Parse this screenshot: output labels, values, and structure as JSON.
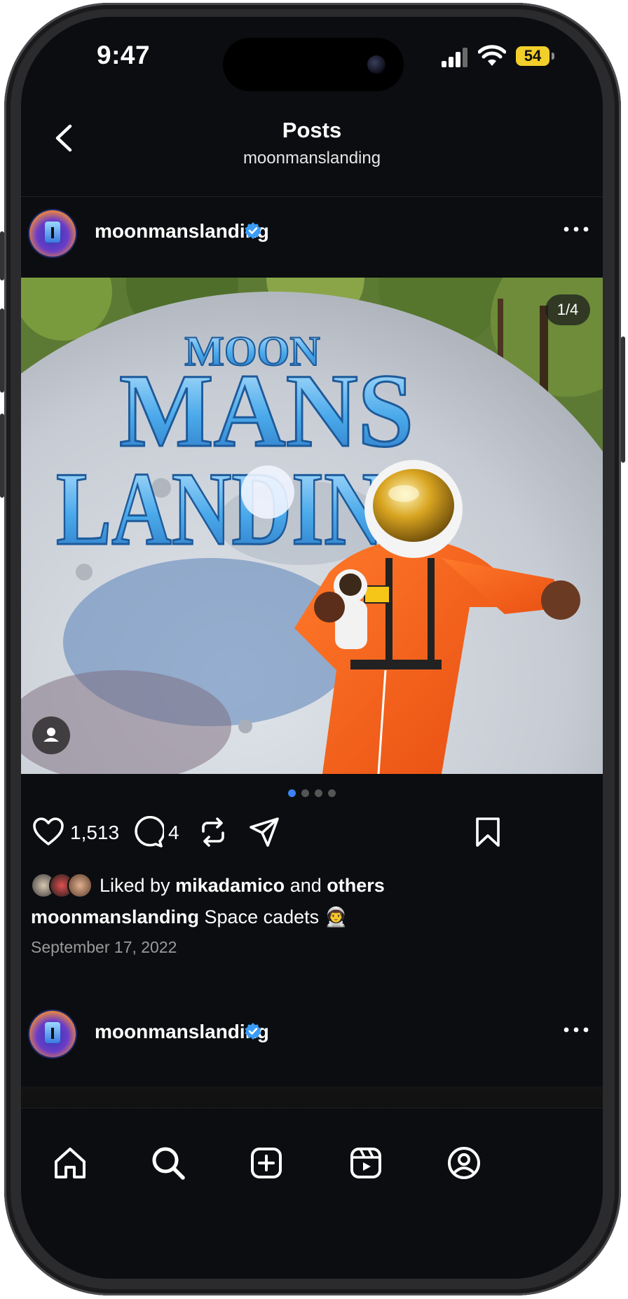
{
  "status_bar": {
    "time": "9:47",
    "battery": "54",
    "battery_color": "#f2cf2a"
  },
  "header": {
    "title": "Posts",
    "subtitle": "moonmanslanding"
  },
  "post": {
    "username": "moonmanslanding",
    "image_counter": "1/4",
    "image_alt": "MOON MANS LANDING",
    "carousel": {
      "total": 4,
      "active": 1
    },
    "actions": {
      "like_count": "1,513",
      "comment_count": "4"
    },
    "liked_by": {
      "prefix": "Liked by",
      "user": "mikadamico",
      "conj": "and",
      "others": "others"
    },
    "caption": {
      "username": "moonmanslanding",
      "text": "Space cadets 👨‍🚀"
    },
    "date": "September 17, 2022"
  },
  "post2": {
    "username": "moonmanslanding"
  },
  "icons": {
    "back": "chevron-left-icon",
    "verified": "verified-badge-icon",
    "more": "more-horizontal-icon",
    "like": "heart-icon",
    "comment": "comment-bubble-icon",
    "repost": "repost-icon",
    "share": "paper-plane-icon",
    "save": "bookmark-icon",
    "tabs": [
      "home-icon",
      "search-icon",
      "create-icon",
      "reels-icon",
      "profile-icon"
    ]
  },
  "colors": {
    "background": "#0b0d10",
    "accent_blue": "#3b82f6",
    "text": "#ffffff",
    "muted": "#9a9a9a"
  }
}
